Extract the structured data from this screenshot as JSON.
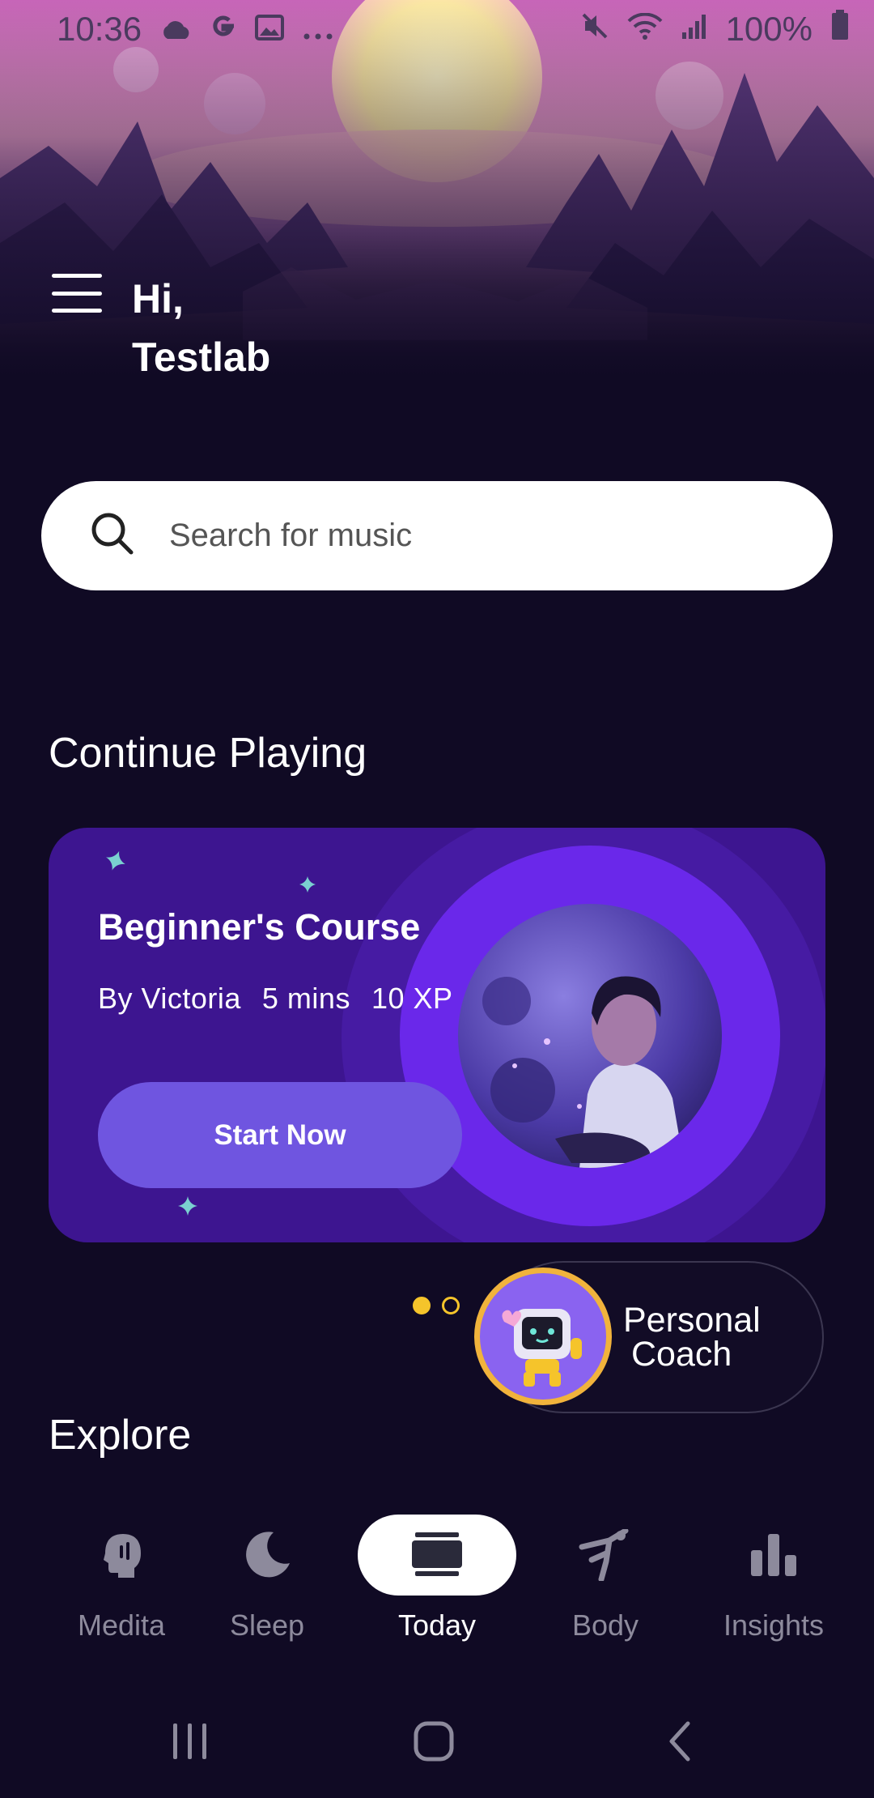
{
  "status_bar": {
    "time": "10:36",
    "battery": "100%",
    "icons": [
      "cloud-icon",
      "google-icon",
      "image-icon",
      "more-icon",
      "mute-icon",
      "wifi-icon",
      "signal-icon",
      "battery-icon"
    ]
  },
  "header": {
    "greeting_line1": "Hi,",
    "greeting_line2": "Testlab",
    "menu_icon": "hamburger-menu-icon"
  },
  "search": {
    "placeholder": "Search for music",
    "icon": "search-icon"
  },
  "continue_playing": {
    "section_title": "Continue Playing",
    "card": {
      "title": "Beginner's Course",
      "author": "By Victoria",
      "duration": "5 mins",
      "xp": "10 XP",
      "button_label": "Start Now"
    },
    "pager": {
      "total": 2,
      "active_index": 0
    }
  },
  "coach": {
    "label_line1": "Personal",
    "label_line2": "Coach"
  },
  "explore": {
    "section_title": "Explore"
  },
  "bottom_nav": {
    "items": [
      {
        "label": "Medita",
        "icon": "meditate-head-icon",
        "active": false
      },
      {
        "label": "Sleep",
        "icon": "moon-icon",
        "active": false
      },
      {
        "label": "Today",
        "icon": "cards-stack-icon",
        "active": true
      },
      {
        "label": "Body",
        "icon": "yoga-pose-icon",
        "active": false
      },
      {
        "label": "Insights",
        "icon": "bar-chart-icon",
        "active": false
      }
    ]
  },
  "system_nav": {
    "icons": [
      "recent-apps-icon",
      "home-icon",
      "back-icon"
    ]
  },
  "colors": {
    "background": "#100a24",
    "card": "#3d1590",
    "button": "#6f55e0",
    "accent_yellow": "#f5c42b"
  }
}
